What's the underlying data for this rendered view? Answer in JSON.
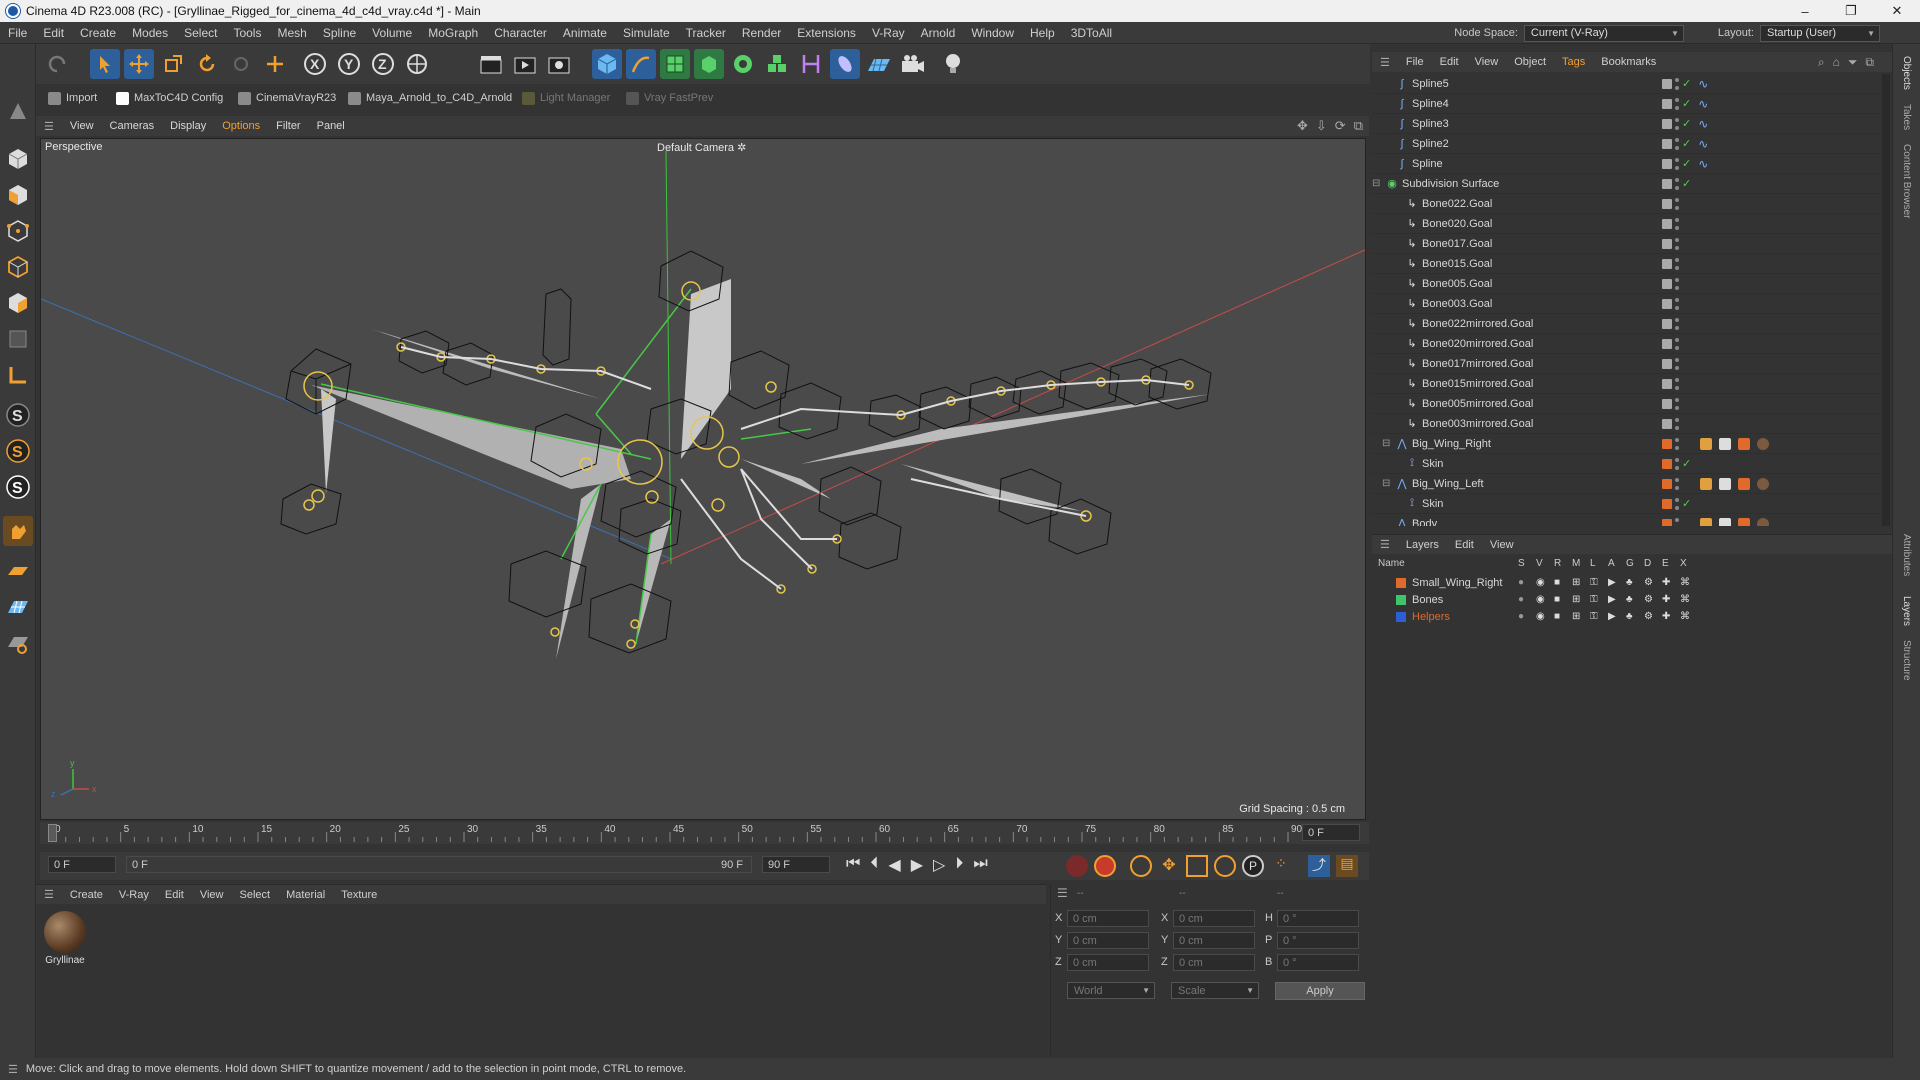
{
  "window": {
    "title": "Cinema 4D R23.008 (RC) - [Gryllinae_Rigged_for_cinema_4d_c4d_vray.c4d *] - Main",
    "minimize": "–",
    "maximize": "❐",
    "close": "✕"
  },
  "menubar": {
    "items": [
      "File",
      "Edit",
      "Create",
      "Modes",
      "Select",
      "Tools",
      "Mesh",
      "Spline",
      "Volume",
      "MoGraph",
      "Character",
      "Animate",
      "Simulate",
      "Tracker",
      "Render",
      "Extensions",
      "V-Ray",
      "Arnold",
      "Window",
      "Help",
      "3DToAll"
    ],
    "node_space_label": "Node Space:",
    "node_space_value": "Current (V-Ray)",
    "layout_label": "Layout:",
    "layout_value": "Startup (User)"
  },
  "plugins": {
    "import": "Import",
    "maxtoc4d": "MaxToC4D Config",
    "cinemavray": "CinemaVrayR23",
    "maya_arnold": "Maya_Arnold_to_C4D_Arnold",
    "light_manager": "Light Manager",
    "vray_fastprev": "Vray FastPrev"
  },
  "viewport": {
    "menu": [
      "View",
      "Cameras",
      "Display",
      "Options",
      "Filter",
      "Panel"
    ],
    "label": "Perspective",
    "camera": "Default Camera",
    "grid_spacing": "Grid Spacing : 0.5 cm"
  },
  "timeline": {
    "ticks": [
      "0",
      "5",
      "10",
      "15",
      "20",
      "25",
      "30",
      "35",
      "40",
      "45",
      "50",
      "55",
      "60",
      "65",
      "70",
      "75",
      "80",
      "85",
      "90"
    ],
    "current_frame": "0 F",
    "start_field": "0 F",
    "range_start": "0 F",
    "range_end": "90 F",
    "end_field": "90 F"
  },
  "material_manager": {
    "menu": [
      "Create",
      "V-Ray",
      "Edit",
      "View",
      "Select",
      "Material",
      "Texture"
    ],
    "materials": [
      {
        "name": "Gryllinae"
      }
    ]
  },
  "coordinates": {
    "header": [
      "--",
      "--",
      "--"
    ],
    "rows": [
      {
        "a_label": "X",
        "a_val": "0 cm",
        "b_label": "X",
        "b_val": "0 cm",
        "c_label": "H",
        "c_val": "0 °"
      },
      {
        "a_label": "Y",
        "a_val": "0 cm",
        "b_label": "Y",
        "b_val": "0 cm",
        "c_label": "P",
        "c_val": "0 °"
      },
      {
        "a_label": "Z",
        "a_val": "0 cm",
        "b_label": "Z",
        "b_val": "0 cm",
        "c_label": "B",
        "c_val": "0 °"
      }
    ],
    "world": "World",
    "scale": "Scale",
    "apply": "Apply"
  },
  "object_manager": {
    "menu": [
      "File",
      "Edit",
      "View",
      "Object",
      "Tags",
      "Bookmarks"
    ],
    "rows": [
      {
        "name": "Spline5",
        "indent": 1,
        "icon": "spline",
        "swatch": "",
        "check": true,
        "tag": "spline"
      },
      {
        "name": "Spline4",
        "indent": 1,
        "icon": "spline",
        "swatch": "",
        "check": true,
        "tag": "spline"
      },
      {
        "name": "Spline3",
        "indent": 1,
        "icon": "spline",
        "swatch": "",
        "check": true,
        "tag": "spline"
      },
      {
        "name": "Spline2",
        "indent": 1,
        "icon": "spline",
        "swatch": "",
        "check": true,
        "tag": "spline"
      },
      {
        "name": "Spline",
        "indent": 1,
        "icon": "spline",
        "swatch": "",
        "check": true,
        "tag": "spline"
      },
      {
        "name": "Subdivision Surface",
        "indent": 0,
        "icon": "subdiv",
        "swatch": "",
        "check": true,
        "tag": ""
      },
      {
        "name": "Bone022.Goal",
        "indent": 2,
        "icon": "null",
        "swatch": "",
        "check": false,
        "tag": ""
      },
      {
        "name": "Bone020.Goal",
        "indent": 2,
        "icon": "null",
        "swatch": "",
        "check": false,
        "tag": ""
      },
      {
        "name": "Bone017.Goal",
        "indent": 2,
        "icon": "null",
        "swatch": "",
        "check": false,
        "tag": ""
      },
      {
        "name": "Bone015.Goal",
        "indent": 2,
        "icon": "null",
        "swatch": "",
        "check": false,
        "tag": ""
      },
      {
        "name": "Bone005.Goal",
        "indent": 2,
        "icon": "null",
        "swatch": "",
        "check": false,
        "tag": ""
      },
      {
        "name": "Bone003.Goal",
        "indent": 2,
        "icon": "null",
        "swatch": "",
        "check": false,
        "tag": ""
      },
      {
        "name": "Bone022mirrored.Goal",
        "indent": 2,
        "icon": "null",
        "swatch": "",
        "check": false,
        "tag": ""
      },
      {
        "name": "Bone020mirrored.Goal",
        "indent": 2,
        "icon": "null",
        "swatch": "",
        "check": false,
        "tag": ""
      },
      {
        "name": "Bone017mirrored.Goal",
        "indent": 2,
        "icon": "null",
        "swatch": "",
        "check": false,
        "tag": ""
      },
      {
        "name": "Bone015mirrored.Goal",
        "indent": 2,
        "icon": "null",
        "swatch": "",
        "check": false,
        "tag": ""
      },
      {
        "name": "Bone005mirrored.Goal",
        "indent": 2,
        "icon": "null",
        "swatch": "",
        "check": false,
        "tag": ""
      },
      {
        "name": "Bone003mirrored.Goal",
        "indent": 2,
        "icon": "null",
        "swatch": "",
        "check": false,
        "tag": ""
      },
      {
        "name": "Big_Wing_Right",
        "indent": 1,
        "icon": "mesh",
        "swatch": "#e06a2a",
        "check": false,
        "tag": "material"
      },
      {
        "name": "Skin",
        "indent": 2,
        "icon": "skin",
        "swatch": "#e06a2a",
        "check": true,
        "tag": ""
      },
      {
        "name": "Big_Wing_Left",
        "indent": 1,
        "icon": "mesh",
        "swatch": "#e06a2a",
        "check": false,
        "tag": "material"
      },
      {
        "name": "Skin",
        "indent": 2,
        "icon": "skin",
        "swatch": "#e06a2a",
        "check": true,
        "tag": ""
      },
      {
        "name": "Body",
        "indent": 1,
        "icon": "mesh",
        "swatch": "#e06a2a",
        "check": false,
        "tag": "material"
      }
    ]
  },
  "layers": {
    "menu": [
      "Layers",
      "Edit",
      "View"
    ],
    "header": {
      "name": "Name",
      "cols": [
        "S",
        "V",
        "R",
        "M",
        "L",
        "A",
        "G",
        "D",
        "E",
        "X"
      ]
    },
    "rows": [
      {
        "name": "Small_Wing_Right",
        "color": "#e06a2a",
        "text_color": "#d8d8d8"
      },
      {
        "name": "Bones",
        "color": "#3fc46a",
        "text_color": "#d8d8d8"
      },
      {
        "name": "Helpers",
        "color": "#2a5fd8",
        "text_color": "#e06a2a"
      }
    ]
  },
  "right_tabs": [
    "Objects",
    "Takes",
    "Content Browser",
    "Attributes",
    "Layers",
    "Structure"
  ],
  "status": {
    "text": "Move: Click and drag to move elements. Hold down SHIFT to quantize movement / add to the selection in point mode, CTRL to remove."
  }
}
